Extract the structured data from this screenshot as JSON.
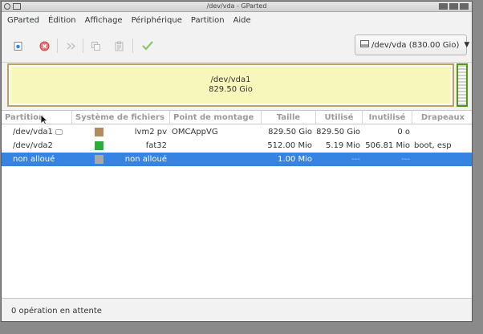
{
  "window": {
    "title": "/dev/vda - GParted"
  },
  "menu": [
    "GParted",
    "Édition",
    "Affichage",
    "Périphérique",
    "Partition",
    "Aide"
  ],
  "toolbar": {
    "icons": [
      "new-partition-icon",
      "delete-icon",
      "resize-move-icon",
      "copy-icon",
      "paste-icon",
      "apply-icon"
    ],
    "device": "/dev/vda (830.00 Gio)"
  },
  "graph": {
    "partition_name": "/dev/vda1",
    "partition_size": "829.50 Gio"
  },
  "table": {
    "headers": [
      "Partition",
      "Système de fichiers",
      "Point de montage",
      "Taille",
      "Utilisé",
      "Inutilisé",
      "Drapeaux"
    ],
    "rows": [
      {
        "partition": "/dev/vda1",
        "filesystem": "lvm2 pv",
        "mount": "OMCAppVG",
        "size": "829.50 Gio",
        "used": "829.50 Gio",
        "unused": "0 o",
        "flags": "",
        "color": "#b08c5e",
        "selected": false
      },
      {
        "partition": "/dev/vda2",
        "filesystem": "fat32",
        "mount": "",
        "size": "512.00 Mio",
        "used": "5.19 Mio",
        "unused": "506.81 Mio",
        "flags": "boot, esp",
        "color": "#2cab3e",
        "selected": false
      },
      {
        "partition": "non alloué",
        "filesystem": "non alloué",
        "mount": "",
        "size": "1.00 Mio",
        "used": "---",
        "unused": "---",
        "flags": "",
        "color": "#a8a8a8",
        "selected": true
      }
    ]
  },
  "status": {
    "text": "0 opération en attente"
  },
  "colors": {
    "selection": "#3584e4",
    "partition_fill": "#f7f7bb",
    "lvm_border": "#c0a060",
    "fat32_border": "#4e9a06"
  }
}
